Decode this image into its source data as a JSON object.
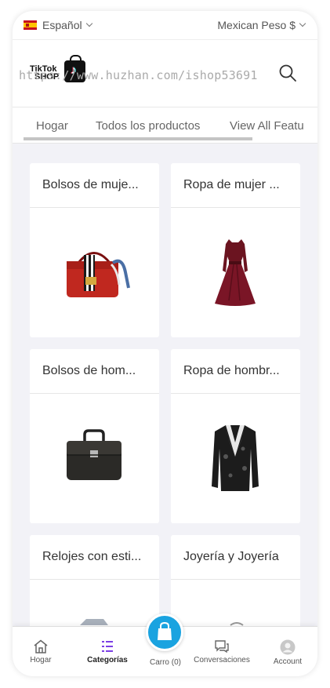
{
  "topbar": {
    "language": "Español",
    "currency": "Mexican Peso $"
  },
  "header": {
    "logo_text_line1": "TikTok",
    "logo_text_line2": "SHOP",
    "watermark": "https://www.huzhan.com/ishop53691"
  },
  "tabs": [
    "Hogar",
    "Todos los productos",
    "View All Featu"
  ],
  "categories": [
    {
      "label": "Bolsos de muje...",
      "icon": "handbag-image"
    },
    {
      "label": "Ropa de mujer ...",
      "icon": "dress-image"
    },
    {
      "label": "Bolsos de hom...",
      "icon": "briefcase-image"
    },
    {
      "label": "Ropa de hombr...",
      "icon": "blazer-image"
    },
    {
      "label": "Relojes con esti...",
      "icon": "watch-image"
    },
    {
      "label": "Joyería y Joyería",
      "icon": "jewelry-image"
    }
  ],
  "bottom_nav": {
    "home": "Hogar",
    "categories": "Categorías",
    "cart": "Carro (0)",
    "conversations": "Conversaciones",
    "account": "Account"
  },
  "colors": {
    "accent": "#1aa3e0",
    "active_icon": "#7b3fe4",
    "background": "#f2f2f7"
  }
}
